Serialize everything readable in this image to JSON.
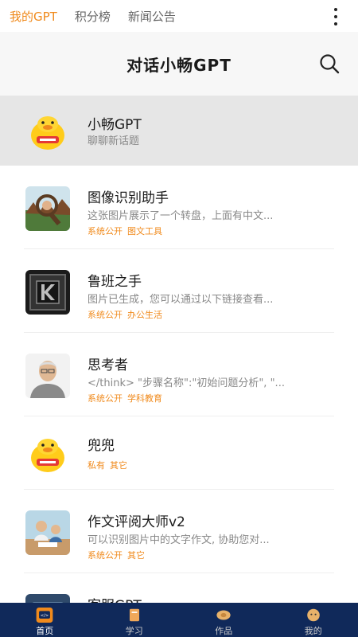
{
  "top_nav": {
    "tabs": [
      {
        "label": "我的GPT",
        "active": true
      },
      {
        "label": "积分榜",
        "active": false
      },
      {
        "label": "新闻公告",
        "active": false
      }
    ]
  },
  "header": {
    "title": "对话小畅GPT"
  },
  "bots": [
    {
      "name": "小畅GPT",
      "desc": "聊聊新话题",
      "tags": [],
      "avatar": "duck-mascot-icon"
    },
    {
      "name": "图像识别助手",
      "desc": "这张图片展示了一个转盘，上面有中文...",
      "tags": [
        "系统公开",
        "图文工具"
      ],
      "avatar": "magnifier-photo-icon"
    },
    {
      "name": "鲁班之手",
      "desc": "图片已生成，您可以通过以下链接查看...",
      "tags": [
        "系统公开",
        "办公生活"
      ],
      "avatar": "metal-logo-icon"
    },
    {
      "name": "思考者",
      "desc": "</think> \"步骤名称\":\"初始问题分析\", \"...",
      "tags": [
        "系统公开",
        "学科教育"
      ],
      "avatar": "elder-portrait-icon"
    },
    {
      "name": "兜兜",
      "desc": "",
      "tags": [
        "私有",
        "其它"
      ],
      "avatar": "duck-mascot-icon"
    },
    {
      "name": "作文评阅大师v2",
      "desc": "可以识别图片中的文字作文, 协助您对...",
      "tags": [
        "系统公开",
        "其它"
      ],
      "avatar": "study-scene-icon"
    },
    {
      "name": "客服GPT",
      "desc": "",
      "tags": [],
      "avatar": "service-icon"
    }
  ],
  "bottom_nav": {
    "items": [
      {
        "label": "首页",
        "active": true
      },
      {
        "label": "学习",
        "active": false
      },
      {
        "label": "作品",
        "active": false
      },
      {
        "label": "我的",
        "active": false
      }
    ]
  },
  "colors": {
    "accent": "#f08a1c",
    "bottom_bar": "#10295a",
    "header_bg": "#f7f7f7",
    "selected_row": "#e6e6e6"
  }
}
